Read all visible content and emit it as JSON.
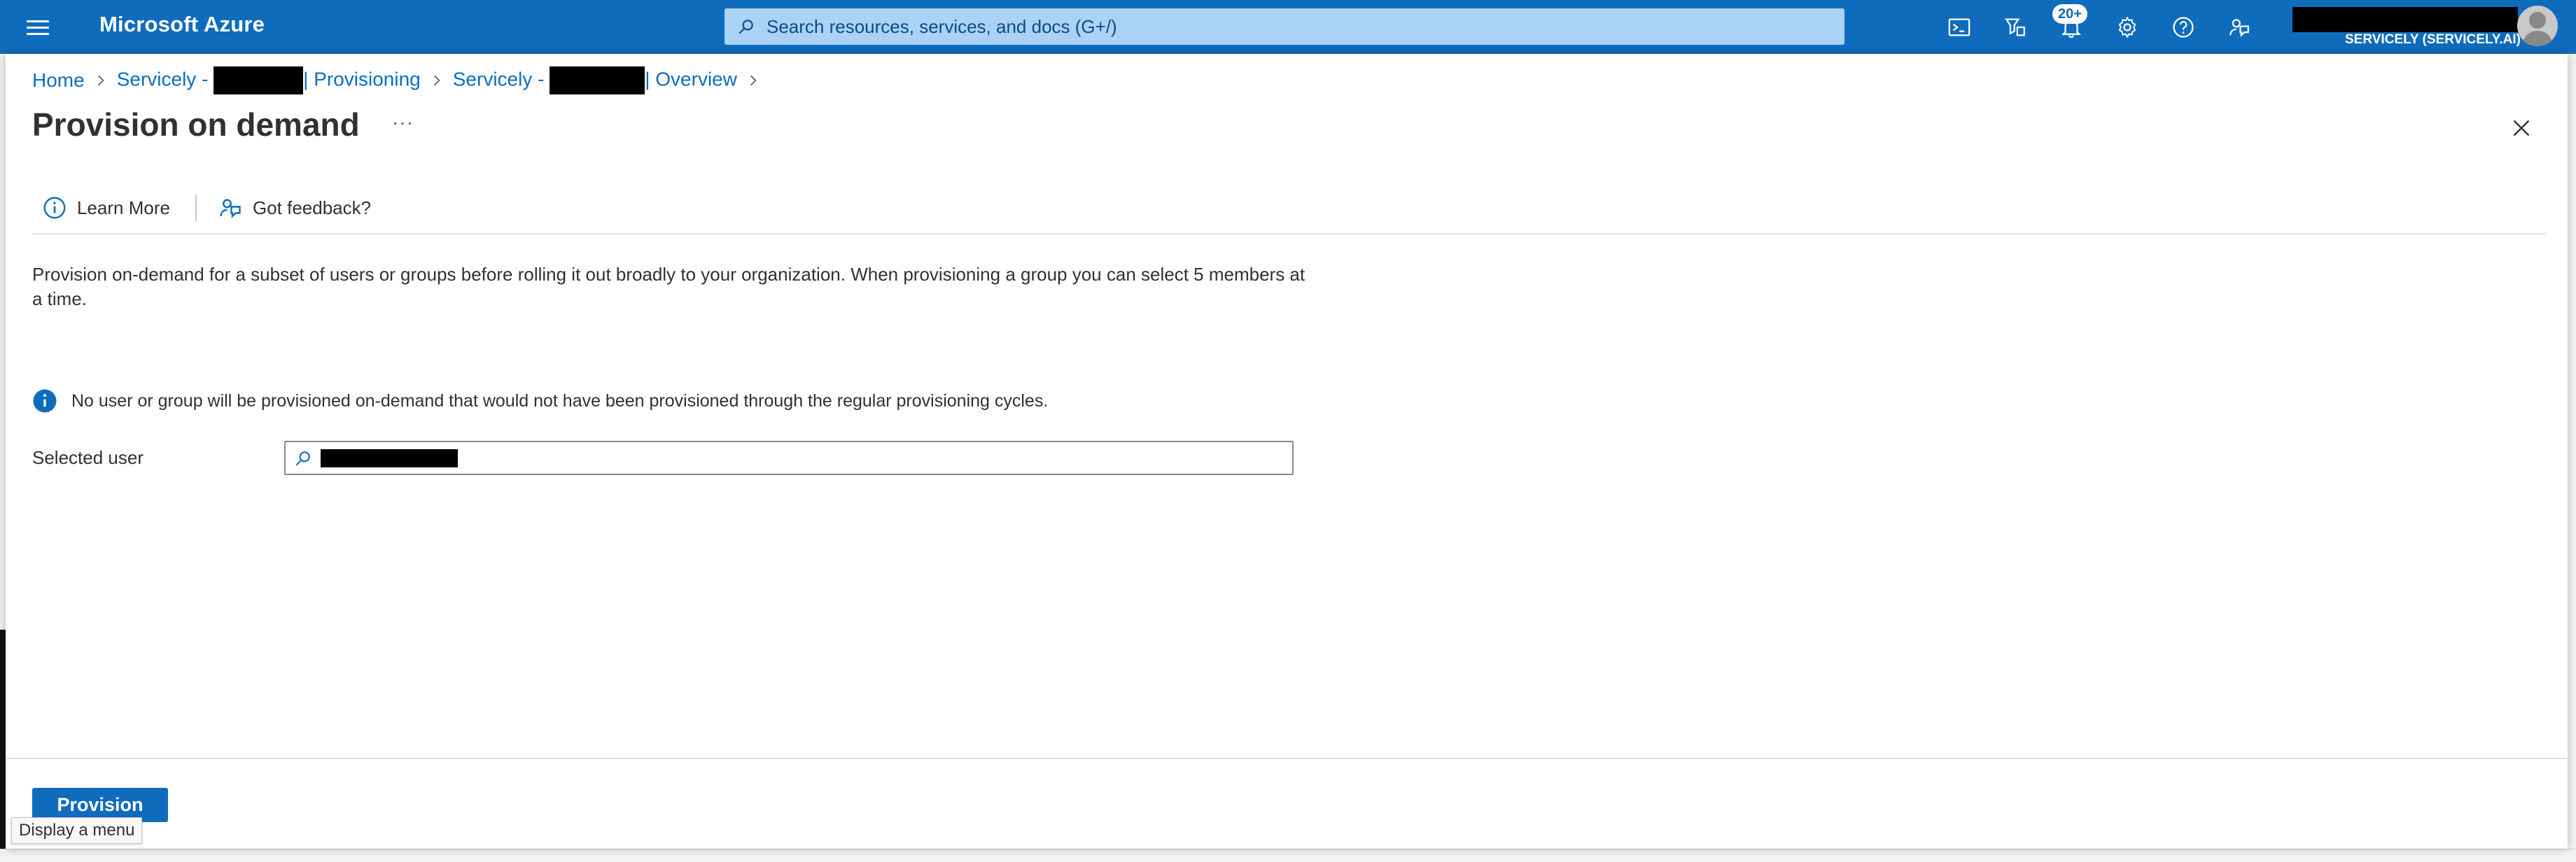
{
  "topbar": {
    "brand": "Microsoft Azure",
    "search_placeholder": "Search resources, services, and docs (G+/)",
    "notification_badge": "20+",
    "account_name": "SERVICELY (SERVICELY.AI)",
    "icons": [
      "menu-icon",
      "cloud-shell-icon",
      "directory-filter-icon",
      "notifications-icon",
      "settings-icon",
      "help-icon",
      "feedback-icon"
    ],
    "accent_color": "#0f6cbd"
  },
  "breadcrumb": {
    "home": "Home",
    "app_prefix_1": "Servicely - ",
    "provisioning": "| Provisioning",
    "app_prefix_2": "Servicely - ",
    "overview": "| Overview"
  },
  "blade": {
    "title": "Provision on demand",
    "more_label": "···",
    "toolbar": {
      "learn_more": "Learn More",
      "feedback": "Got feedback?"
    },
    "description": "Provision on-demand for a subset of users or groups before rolling it out broadly to your organization. When provisioning a group you can select 5 members at a time.",
    "info_message": "No user or group will be provisioned on-demand that would not have been provisioned through the regular provisioning cycles.",
    "selected_user_label": "Selected user",
    "provision_button": "Provision"
  },
  "tooltip": "Display a menu"
}
